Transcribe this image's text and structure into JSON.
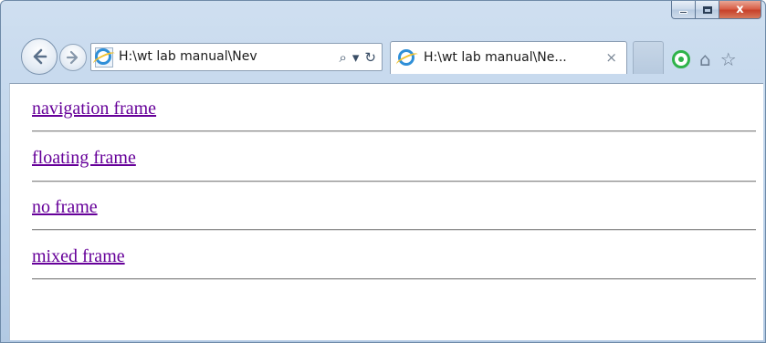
{
  "window": {
    "caption_buttons": {
      "minimize_icon": "minimize-icon",
      "maximize_icon": "maximize-icon",
      "close_label": "x"
    }
  },
  "navigation": {
    "back_icon": "back-arrow-icon",
    "forward_icon": "forward-arrow-icon",
    "address": "H:\\wt lab manual\\Nev",
    "search_icon": "⌕",
    "dropdown_icon": "▾",
    "refresh_icon": "↻"
  },
  "tab": {
    "title": "H:\\wt lab manual\\Ne...",
    "close_label": "×"
  },
  "toolbar": {
    "home_icon": "⌂",
    "favorites_icon": "☆"
  },
  "content": {
    "links": [
      {
        "label": "navigation frame"
      },
      {
        "label": "floating frame"
      },
      {
        "label": "no frame"
      },
      {
        "label": "mixed frame"
      }
    ],
    "link_color": "#660099"
  }
}
